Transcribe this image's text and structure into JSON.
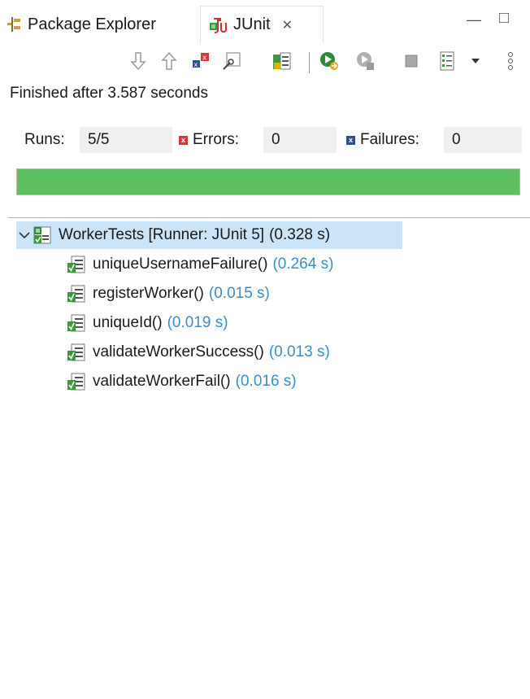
{
  "tabs": [
    {
      "label": "Package Explorer",
      "icon": "package-explorer-icon"
    },
    {
      "label": "JUnit",
      "icon": "junit-icon",
      "active": true
    }
  ],
  "window_controls": {
    "minimize": "—",
    "maximize": "□"
  },
  "toolbar_icons": [
    "next-failure-icon",
    "previous-failure-icon",
    "show-failures-only-icon",
    "scroll-lock-icon",
    "show-skipped-icon",
    "rerun-test-icon",
    "rerun-failed-first-icon",
    "stop-icon",
    "test-run-history-icon",
    "dropdown-icon",
    "view-menu-icon"
  ],
  "status": {
    "text": "Finished after 3.587 seconds"
  },
  "counters": {
    "runs_label": "Runs:",
    "runs_value": "5/5",
    "errors_label": "Errors:",
    "errors_value": "0",
    "failures_label": "Failures:",
    "failures_value": "0"
  },
  "progress": {
    "fraction": 1.0,
    "color": "#5dc160"
  },
  "tree": {
    "root": {
      "name": "WorkerTests [Runner: JUnit 5]",
      "time": "(0.328 s)"
    },
    "children": [
      {
        "name": "uniqueUsernameFailure()",
        "time": "(0.264 s)"
      },
      {
        "name": "registerWorker()",
        "time": "(0.015 s)"
      },
      {
        "name": "uniqueId()",
        "time": "(0.019 s)"
      },
      {
        "name": "validateWorkerSuccess()",
        "time": "(0.013 s)"
      },
      {
        "name": "validateWorkerFail()",
        "time": "(0.016 s)"
      }
    ]
  },
  "colors": {
    "selection": "#cce4f7",
    "time_text": "#3b8ec4",
    "error_red": "#d9363e",
    "failure_blue": "#2f4f8f"
  }
}
